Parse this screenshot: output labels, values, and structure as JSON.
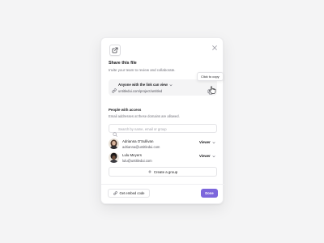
{
  "dialog": {
    "title": "Share this file",
    "subtitle": "Invite your team to review and collaborate.",
    "close_icon": "close-icon",
    "header_icon": "share-icon"
  },
  "link": {
    "permission_label": "Anyone with the link can view",
    "url": "untitledui.com/project/untitled",
    "icon": "link-icon",
    "copy_icon": "copy-icon"
  },
  "tooltip": {
    "text": "Click to copy"
  },
  "access": {
    "title": "People with access",
    "subtitle": "Email addresses at these domains are allowed.",
    "search_placeholder": "Search by name, email or group",
    "search_value": "",
    "people": [
      {
        "name": "Adrianna O'Sullivan",
        "email": "adrianna@untitledui.com",
        "role": "Viewer"
      },
      {
        "name": "Lulu Meyers",
        "email": "lulu@untitledui.com",
        "role": "Viewer"
      }
    ],
    "create_group_label": "Create a group"
  },
  "footer": {
    "embed_label": "Get embed code",
    "done_label": "Done"
  },
  "colors": {
    "accent": "#7c66dc",
    "background": "#f4f4f5",
    "panel": "#ffffff"
  }
}
